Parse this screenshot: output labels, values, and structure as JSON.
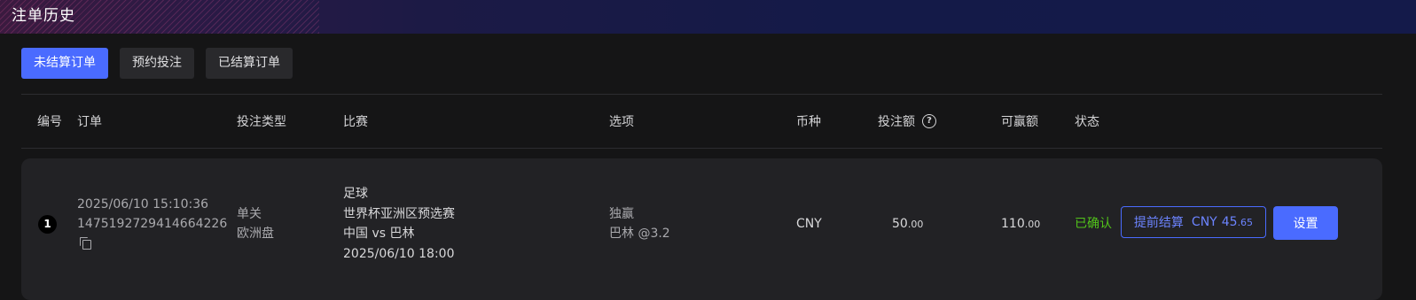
{
  "header": {
    "title": "注单历史"
  },
  "tabs": [
    {
      "label": "未结算订单",
      "active": true
    },
    {
      "label": "预约投注",
      "active": false
    },
    {
      "label": "已结算订单",
      "active": false
    }
  ],
  "columns": {
    "index": "编号",
    "order": "订单",
    "bet_type": "投注类型",
    "match": "比赛",
    "selection": "选项",
    "currency": "币种",
    "stake": "投注额",
    "payout": "可赢额",
    "status": "状态"
  },
  "rows": [
    {
      "index": "1",
      "order_time": "2025/06/10 15:10:36",
      "order_id": "1475192729414664226",
      "bet_type_line1": "单关",
      "bet_type_line2": "欧洲盘",
      "sport": "足球",
      "league": "世界杯亚洲区预选赛",
      "teams": "中国 vs 巴林",
      "match_time": "2025/06/10 18:00",
      "market": "独赢",
      "pick": "巴林 @3.2",
      "currency": "CNY",
      "stake_int": "50",
      "stake_dec": ".00",
      "payout_int": "110",
      "payout_dec": ".00",
      "status": "已确认",
      "cashout_label": "提前结算",
      "cashout_currency": "CNY",
      "cashout_int": "45",
      "cashout_dec": ".65",
      "settings_label": "设置"
    }
  ],
  "colors": {
    "accent": "#4a6bff",
    "status_confirmed": "#52c41a",
    "background": "#151516",
    "row_background": "#222225"
  },
  "icons": {
    "help": "help-circle-icon",
    "copy": "copy-icon"
  }
}
